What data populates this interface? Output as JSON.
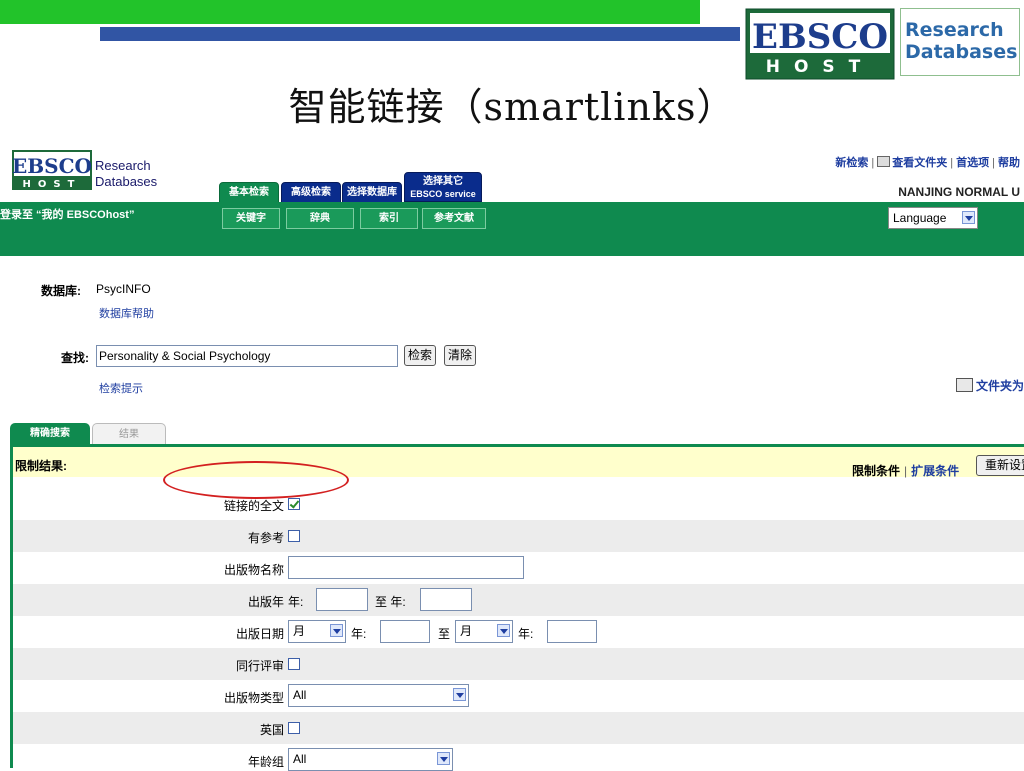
{
  "slide": {
    "title": "智能链接（smartlinks）",
    "logo_ebsco": "EBSCO",
    "logo_host": "HOST",
    "logo_tag": [
      "Research",
      "Databases"
    ]
  },
  "app": {
    "logo_ebsco": "EBSCO",
    "logo_host": "HOST",
    "logo_text": [
      "Research",
      "Databases"
    ],
    "top_links": [
      "新检索",
      "查看文件夹",
      "首选项",
      "帮助"
    ],
    "institution": "NANJING NORMAL U",
    "my_login": "登录至 “我的 EBSCOhost”",
    "tabs": [
      "基本检索",
      "高级检索",
      "选择数据库",
      "选择其它",
      "EBSCO service"
    ],
    "subtabs": [
      "关键字",
      "辞典",
      "索引",
      "参考文献"
    ],
    "language": "Language"
  },
  "search": {
    "db_label": "数据库:",
    "db_value": "PsycINFO",
    "db_help": "数据库帮助",
    "find_label": "查找:",
    "query": "Personality & Social Psychology",
    "search_btn": "检索",
    "clear_btn": "清除",
    "tips": "检索提示",
    "folder": "文件夹为"
  },
  "refine": {
    "tab_on": "精确搜索",
    "tab_off": "结果",
    "limit_title": "限制结果:",
    "limit_cond": "限制条件",
    "expand_cond": "扩展条件",
    "reset": "重新设置",
    "rows": [
      {
        "label": "链接的全文",
        "checked": true
      },
      {
        "label": "有参考",
        "checked": false
      },
      {
        "label": "出版物名称"
      },
      {
        "label": "出版年",
        "year": "年:",
        "to": "至 年:"
      },
      {
        "label": "出版日期",
        "month": "月",
        "year": "年:",
        "to": "至",
        "month2": "月",
        "year2": "年:"
      },
      {
        "label": "同行评审",
        "checked": false
      },
      {
        "label": "出版物类型",
        "value": "All"
      },
      {
        "label": "英国",
        "checked": false
      },
      {
        "label": "年龄组",
        "value": "All"
      }
    ]
  }
}
